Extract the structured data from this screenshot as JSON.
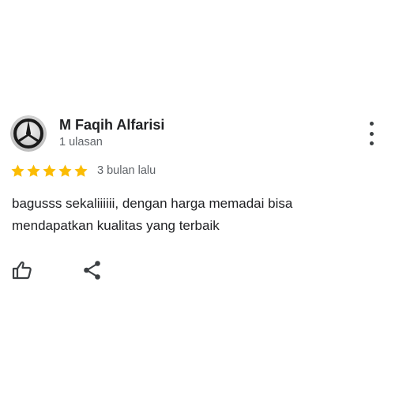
{
  "review": {
    "author": {
      "name": "M Faqih Alfarisi",
      "review_count": "1 ulasan",
      "avatar_icon": "mercedes-emblem-avatar"
    },
    "rating": {
      "stars": 5,
      "max_stars": 5,
      "star_color": "#fbbc04",
      "date": "3 bulan lalu"
    },
    "text_lines": [
      "bagusss sekaliiiiii, dengan harga memadai bisa",
      "mendapatkan kualitas yang terbaik"
    ],
    "actions": {
      "like_icon": "thumbs-up-icon",
      "share_icon": "share-icon",
      "more_icon": "more-vertical-icon"
    }
  }
}
